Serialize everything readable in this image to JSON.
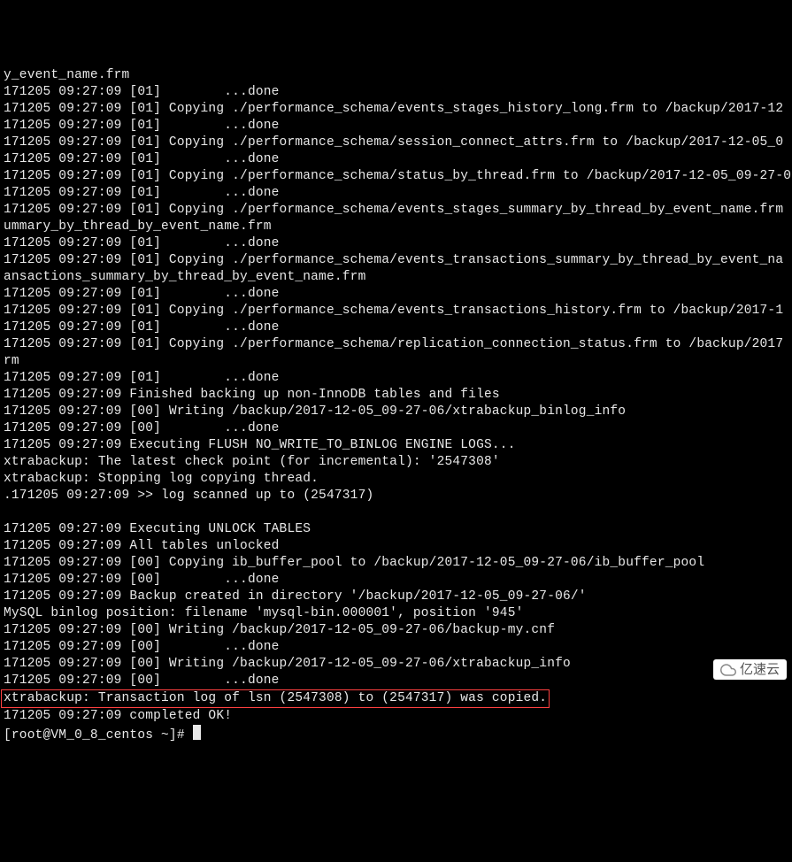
{
  "lines": [
    "y_event_name.frm",
    "171205 09:27:09 [01]        ...done",
    "171205 09:27:09 [01] Copying ./performance_schema/events_stages_history_long.frm to /backup/2017-12",
    "171205 09:27:09 [01]        ...done",
    "171205 09:27:09 [01] Copying ./performance_schema/session_connect_attrs.frm to /backup/2017-12-05_0",
    "171205 09:27:09 [01]        ...done",
    "171205 09:27:09 [01] Copying ./performance_schema/status_by_thread.frm to /backup/2017-12-05_09-27-0",
    "171205 09:27:09 [01]        ...done",
    "171205 09:27:09 [01] Copying ./performance_schema/events_stages_summary_by_thread_by_event_name.frm",
    "ummary_by_thread_by_event_name.frm",
    "171205 09:27:09 [01]        ...done",
    "171205 09:27:09 [01] Copying ./performance_schema/events_transactions_summary_by_thread_by_event_na",
    "ansactions_summary_by_thread_by_event_name.frm",
    "171205 09:27:09 [01]        ...done",
    "171205 09:27:09 [01] Copying ./performance_schema/events_transactions_history.frm to /backup/2017-1",
    "171205 09:27:09 [01]        ...done",
    "171205 09:27:09 [01] Copying ./performance_schema/replication_connection_status.frm to /backup/2017",
    "rm",
    "171205 09:27:09 [01]        ...done",
    "171205 09:27:09 Finished backing up non-InnoDB tables and files",
    "171205 09:27:09 [00] Writing /backup/2017-12-05_09-27-06/xtrabackup_binlog_info",
    "171205 09:27:09 [00]        ...done",
    "171205 09:27:09 Executing FLUSH NO_WRITE_TO_BINLOG ENGINE LOGS...",
    "xtrabackup: The latest check point (for incremental): '2547308'",
    "xtrabackup: Stopping log copying thread.",
    ".171205 09:27:09 >> log scanned up to (2547317)",
    "",
    "171205 09:27:09 Executing UNLOCK TABLES",
    "171205 09:27:09 All tables unlocked",
    "171205 09:27:09 [00] Copying ib_buffer_pool to /backup/2017-12-05_09-27-06/ib_buffer_pool",
    "171205 09:27:09 [00]        ...done",
    "171205 09:27:09 Backup created in directory '/backup/2017-12-05_09-27-06/'",
    "MySQL binlog position: filename 'mysql-bin.000001', position '945'",
    "171205 09:27:09 [00] Writing /backup/2017-12-05_09-27-06/backup-my.cnf",
    "171205 09:27:09 [00]        ...done",
    "171205 09:27:09 [00] Writing /backup/2017-12-05_09-27-06/xtrabackup_info",
    "171205 09:27:09 [00]        ...done"
  ],
  "highlight_line": "xtrabackup: Transaction log of lsn (2547308) to (2547317) was copied.",
  "completed_line": "171205 09:27:09 completed OK!",
  "prompt": "[root@VM_0_8_centos ~]# ",
  "watermark": "亿速云"
}
